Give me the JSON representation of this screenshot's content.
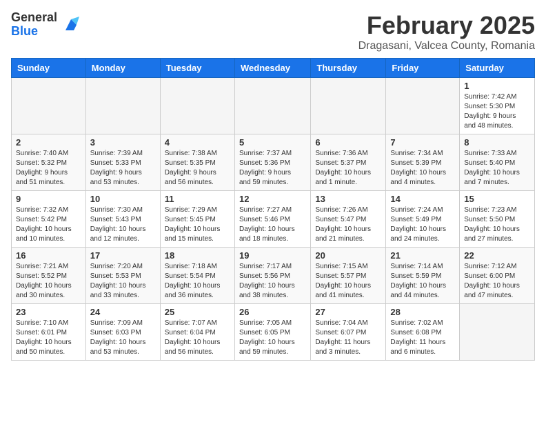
{
  "header": {
    "logo_general": "General",
    "logo_blue": "Blue",
    "month_title": "February 2025",
    "location": "Dragasani, Valcea County, Romania"
  },
  "days_of_week": [
    "Sunday",
    "Monday",
    "Tuesday",
    "Wednesday",
    "Thursday",
    "Friday",
    "Saturday"
  ],
  "weeks": [
    [
      {
        "day": "",
        "info": ""
      },
      {
        "day": "",
        "info": ""
      },
      {
        "day": "",
        "info": ""
      },
      {
        "day": "",
        "info": ""
      },
      {
        "day": "",
        "info": ""
      },
      {
        "day": "",
        "info": ""
      },
      {
        "day": "1",
        "info": "Sunrise: 7:42 AM\nSunset: 5:30 PM\nDaylight: 9 hours\nand 48 minutes."
      }
    ],
    [
      {
        "day": "2",
        "info": "Sunrise: 7:40 AM\nSunset: 5:32 PM\nDaylight: 9 hours\nand 51 minutes."
      },
      {
        "day": "3",
        "info": "Sunrise: 7:39 AM\nSunset: 5:33 PM\nDaylight: 9 hours\nand 53 minutes."
      },
      {
        "day": "4",
        "info": "Sunrise: 7:38 AM\nSunset: 5:35 PM\nDaylight: 9 hours\nand 56 minutes."
      },
      {
        "day": "5",
        "info": "Sunrise: 7:37 AM\nSunset: 5:36 PM\nDaylight: 9 hours\nand 59 minutes."
      },
      {
        "day": "6",
        "info": "Sunrise: 7:36 AM\nSunset: 5:37 PM\nDaylight: 10 hours\nand 1 minute."
      },
      {
        "day": "7",
        "info": "Sunrise: 7:34 AM\nSunset: 5:39 PM\nDaylight: 10 hours\nand 4 minutes."
      },
      {
        "day": "8",
        "info": "Sunrise: 7:33 AM\nSunset: 5:40 PM\nDaylight: 10 hours\nand 7 minutes."
      }
    ],
    [
      {
        "day": "9",
        "info": "Sunrise: 7:32 AM\nSunset: 5:42 PM\nDaylight: 10 hours\nand 10 minutes."
      },
      {
        "day": "10",
        "info": "Sunrise: 7:30 AM\nSunset: 5:43 PM\nDaylight: 10 hours\nand 12 minutes."
      },
      {
        "day": "11",
        "info": "Sunrise: 7:29 AM\nSunset: 5:45 PM\nDaylight: 10 hours\nand 15 minutes."
      },
      {
        "day": "12",
        "info": "Sunrise: 7:27 AM\nSunset: 5:46 PM\nDaylight: 10 hours\nand 18 minutes."
      },
      {
        "day": "13",
        "info": "Sunrise: 7:26 AM\nSunset: 5:47 PM\nDaylight: 10 hours\nand 21 minutes."
      },
      {
        "day": "14",
        "info": "Sunrise: 7:24 AM\nSunset: 5:49 PM\nDaylight: 10 hours\nand 24 minutes."
      },
      {
        "day": "15",
        "info": "Sunrise: 7:23 AM\nSunset: 5:50 PM\nDaylight: 10 hours\nand 27 minutes."
      }
    ],
    [
      {
        "day": "16",
        "info": "Sunrise: 7:21 AM\nSunset: 5:52 PM\nDaylight: 10 hours\nand 30 minutes."
      },
      {
        "day": "17",
        "info": "Sunrise: 7:20 AM\nSunset: 5:53 PM\nDaylight: 10 hours\nand 33 minutes."
      },
      {
        "day": "18",
        "info": "Sunrise: 7:18 AM\nSunset: 5:54 PM\nDaylight: 10 hours\nand 36 minutes."
      },
      {
        "day": "19",
        "info": "Sunrise: 7:17 AM\nSunset: 5:56 PM\nDaylight: 10 hours\nand 38 minutes."
      },
      {
        "day": "20",
        "info": "Sunrise: 7:15 AM\nSunset: 5:57 PM\nDaylight: 10 hours\nand 41 minutes."
      },
      {
        "day": "21",
        "info": "Sunrise: 7:14 AM\nSunset: 5:59 PM\nDaylight: 10 hours\nand 44 minutes."
      },
      {
        "day": "22",
        "info": "Sunrise: 7:12 AM\nSunset: 6:00 PM\nDaylight: 10 hours\nand 47 minutes."
      }
    ],
    [
      {
        "day": "23",
        "info": "Sunrise: 7:10 AM\nSunset: 6:01 PM\nDaylight: 10 hours\nand 50 minutes."
      },
      {
        "day": "24",
        "info": "Sunrise: 7:09 AM\nSunset: 6:03 PM\nDaylight: 10 hours\nand 53 minutes."
      },
      {
        "day": "25",
        "info": "Sunrise: 7:07 AM\nSunset: 6:04 PM\nDaylight: 10 hours\nand 56 minutes."
      },
      {
        "day": "26",
        "info": "Sunrise: 7:05 AM\nSunset: 6:05 PM\nDaylight: 10 hours\nand 59 minutes."
      },
      {
        "day": "27",
        "info": "Sunrise: 7:04 AM\nSunset: 6:07 PM\nDaylight: 11 hours\nand 3 minutes."
      },
      {
        "day": "28",
        "info": "Sunrise: 7:02 AM\nSunset: 6:08 PM\nDaylight: 11 hours\nand 6 minutes."
      },
      {
        "day": "",
        "info": ""
      }
    ]
  ]
}
